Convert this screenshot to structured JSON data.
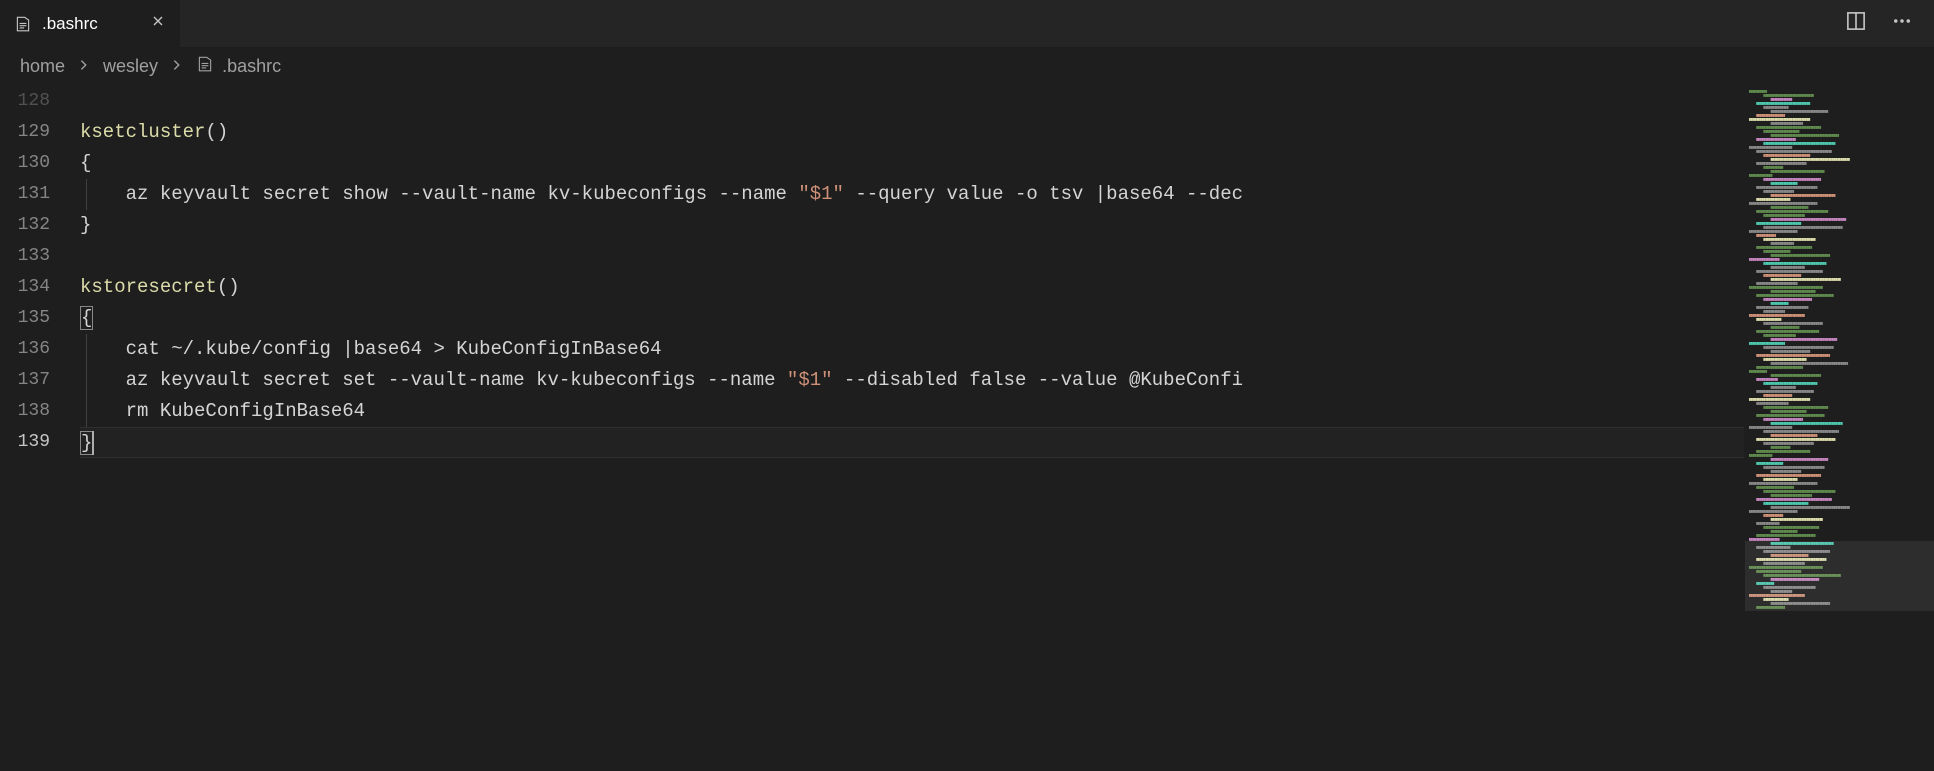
{
  "tab": {
    "filename": ".bashrc"
  },
  "breadcrumbs": {
    "segments": [
      "home",
      "wesley",
      ".bashrc"
    ]
  },
  "editor": {
    "first_line_number": 128,
    "current_line": 139,
    "lines": [
      {
        "n": 128,
        "tokens": []
      },
      {
        "n": 129,
        "tokens": [
          {
            "t": "ksetcluster",
            "c": "tok-fn"
          },
          {
            "t": "()",
            "c": ""
          }
        ]
      },
      {
        "n": 130,
        "tokens": [
          {
            "t": "{",
            "c": ""
          }
        ]
      },
      {
        "n": 131,
        "indent": 1,
        "tokens": [
          {
            "t": "    az keyvault secret show --vault-name kv-kubeconfigs --name ",
            "c": ""
          },
          {
            "t": "\"$1\"",
            "c": "tok-str"
          },
          {
            "t": " --query value -o tsv |base64 --dec",
            "c": ""
          }
        ]
      },
      {
        "n": 132,
        "tokens": [
          {
            "t": "}",
            "c": ""
          }
        ]
      },
      {
        "n": 133,
        "tokens": []
      },
      {
        "n": 134,
        "tokens": [
          {
            "t": "kstoresecret",
            "c": "tok-fn"
          },
          {
            "t": "()",
            "c": ""
          }
        ]
      },
      {
        "n": 135,
        "tokens": [
          {
            "t": "{",
            "c": "tok-brace-match"
          }
        ]
      },
      {
        "n": 136,
        "indent": 1,
        "tokens": [
          {
            "t": "    cat ~/.kube/config |base64 > KubeConfigInBase64",
            "c": ""
          }
        ]
      },
      {
        "n": 137,
        "indent": 1,
        "tokens": [
          {
            "t": "    az keyvault secret set --vault-name kv-kubeconfigs --name ",
            "c": ""
          },
          {
            "t": "\"$1\"",
            "c": "tok-str"
          },
          {
            "t": " --disabled false --value @KubeConfi",
            "c": ""
          }
        ]
      },
      {
        "n": 138,
        "indent": 1,
        "tokens": [
          {
            "t": "    rm KubeConfigInBase64",
            "c": ""
          }
        ]
      },
      {
        "n": 139,
        "tokens": [
          {
            "t": "}",
            "c": "tok-brace-match"
          }
        ],
        "cursor_after": true
      }
    ]
  }
}
